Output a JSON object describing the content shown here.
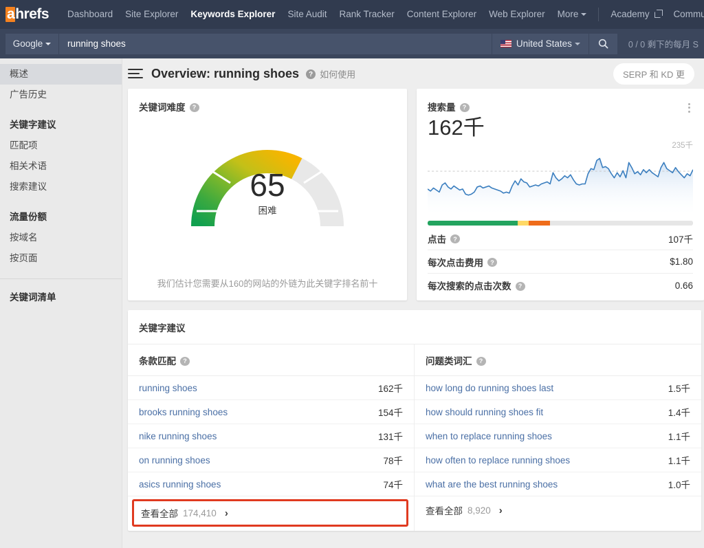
{
  "brand": {
    "logo_a": "a",
    "logo_rest": "hrefs",
    "accent": "#f5821f"
  },
  "topnav": {
    "items": [
      {
        "label": "Dashboard",
        "active": false
      },
      {
        "label": "Site Explorer",
        "active": false
      },
      {
        "label": "Keywords Explorer",
        "active": true
      },
      {
        "label": "Site Audit",
        "active": false
      },
      {
        "label": "Rank Tracker",
        "active": false
      },
      {
        "label": "Content Explorer",
        "active": false
      },
      {
        "label": "Web Explorer",
        "active": false
      },
      {
        "label": "More",
        "active": false,
        "caret": true
      }
    ],
    "right_items": [
      {
        "label": "Academy",
        "external": true
      },
      {
        "label": "Commu",
        "external": false
      }
    ]
  },
  "searchbar": {
    "engine": "Google",
    "keyword_value": "running shoes",
    "keyword_placeholder": "running shoes",
    "country": "United States",
    "search_icon": "search-icon",
    "quota": "0 / 0 剩下的每月 S"
  },
  "sidebar": {
    "items": [
      {
        "label": "概述",
        "selected": true,
        "type": "item"
      },
      {
        "label": "广告历史",
        "selected": false,
        "type": "item"
      },
      {
        "label": "",
        "type": "gap"
      },
      {
        "label": "关键字建议",
        "type": "head"
      },
      {
        "label": "匹配项",
        "type": "item"
      },
      {
        "label": "相关术语",
        "type": "item"
      },
      {
        "label": "搜索建议",
        "type": "item"
      },
      {
        "label": "",
        "type": "gap"
      },
      {
        "label": "流量份额",
        "type": "head"
      },
      {
        "label": "按域名",
        "type": "item"
      },
      {
        "label": "按页面",
        "type": "item"
      },
      {
        "label": "",
        "type": "rule"
      },
      {
        "label": "关键词清单",
        "type": "head"
      }
    ]
  },
  "main_header": {
    "title": "Overview: running shoes",
    "help_glyph": "?",
    "howto_label": "如何使用",
    "serp_pill": "SERP 和 KD 更"
  },
  "kd_card": {
    "label": "关键词难度",
    "value": "65",
    "difficulty_label": "困难",
    "footnote": "我们估计您需要从160的网站的外链为此关键字排名前十",
    "gauge_percent": 65,
    "colors": {
      "start": "#18a05a",
      "mid": "#9dc123",
      "end": "#f5b000",
      "track": "#e6e6e6"
    }
  },
  "volume_card": {
    "label": "搜索量",
    "value": "162千",
    "chart_max_label": "235千",
    "bar_segments": [
      {
        "name": "green",
        "color": "#23a45f",
        "percent": 34
      },
      {
        "name": "yellow",
        "color": "#ffd966",
        "percent": 4
      },
      {
        "name": "orange",
        "color": "#ef6c1a",
        "percent": 8
      },
      {
        "name": "grey",
        "color": "#e6e6e6",
        "percent": 54
      }
    ],
    "stats": [
      {
        "label": "点击",
        "value": "107千",
        "help": true
      },
      {
        "label": "每次点击费用",
        "value": "$1.80",
        "help": true
      },
      {
        "label": "每次搜索的点击次数",
        "value": "0.66",
        "help": true
      }
    ]
  },
  "chart_data": {
    "type": "area",
    "title": "搜索量",
    "xlabel": "",
    "ylabel": "",
    "ylim": [
      0,
      235000
    ],
    "max_label": "235千",
    "current_value": "162千",
    "grid": false,
    "legend": "none",
    "reference_line": {
      "label": "162千",
      "value": 162000,
      "style": "dashed"
    },
    "line_color": "#3f7fbf",
    "fill_gradient": [
      "#cfe2f5",
      "#ffffff"
    ],
    "series": [
      {
        "name": "Monthly search volume",
        "values": [
          92,
          84,
          96,
          88,
          80,
          108,
          116,
          100,
          92,
          104,
          96,
          88,
          92,
          72,
          68,
          72,
          80,
          100,
          104,
          96,
          100,
          104,
          96,
          92,
          88,
          84,
          76,
          80,
          76,
          104,
          124,
          108,
          132,
          120,
          116,
          100,
          104,
          108,
          104,
          112,
          116,
          120,
          112,
          156,
          136,
          124,
          132,
          144,
          136,
          148,
          128,
          112,
          108,
          112,
          112,
          152,
          172,
          168,
          204,
          212,
          176,
          180,
          172,
          152,
          136,
          156,
          140,
          164,
          136,
          196,
          176,
          152,
          160,
          148,
          168,
          156,
          168,
          156,
          148,
          140,
          176,
          196,
          172,
          164,
          156,
          176,
          160,
          148,
          136,
          152,
          144,
          168
        ]
      }
    ]
  },
  "ideas": {
    "title": "关键字建议",
    "columns": [
      {
        "heading": "条款匹配",
        "help": true,
        "rows": [
          {
            "keyword": "running shoes",
            "volume": "162千"
          },
          {
            "keyword": "brooks running shoes",
            "volume": "154千"
          },
          {
            "keyword": "nike running shoes",
            "volume": "131千"
          },
          {
            "keyword": "on running shoes",
            "volume": "78千"
          },
          {
            "keyword": "asics running shoes",
            "volume": "74千"
          }
        ],
        "view_all": {
          "label": "查看全部",
          "count": "174,410",
          "chevron": "›",
          "highlighted": true
        }
      },
      {
        "heading": "问题类词汇",
        "help": true,
        "rows": [
          {
            "keyword": "how long do running shoes last",
            "volume": "1.5千"
          },
          {
            "keyword": "how should running shoes fit",
            "volume": "1.4千"
          },
          {
            "keyword": "when to replace running shoes",
            "volume": "1.1千"
          },
          {
            "keyword": "how often to replace running shoes",
            "volume": "1.1千"
          },
          {
            "keyword": "what are the best running shoes",
            "volume": "1.0千"
          }
        ],
        "view_all": {
          "label": "查看全部",
          "count": "8,920",
          "chevron": "›",
          "highlighted": false
        }
      }
    ]
  }
}
